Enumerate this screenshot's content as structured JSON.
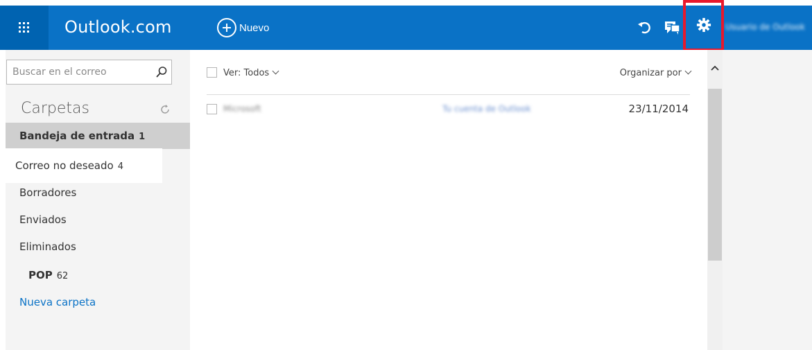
{
  "header": {
    "brand": "Outlook.com",
    "new_label": "Nuevo",
    "user_name": "Usuario de Outlook",
    "accent": "#0a72c6",
    "highlight_color": "#e8182c",
    "icons": [
      "app-launcher-icon",
      "plus-circle-icon",
      "undo-icon",
      "chat-icon",
      "gear-icon"
    ]
  },
  "sidebar": {
    "search_placeholder": "Buscar en el correo",
    "folders_title": "Carpetas",
    "folders": [
      {
        "label": "Bandeja de entrada",
        "count": "1"
      },
      {
        "label": "Correo no deseado",
        "count": "4"
      },
      {
        "label": "Borradores",
        "count": ""
      },
      {
        "label": "Enviados",
        "count": ""
      },
      {
        "label": "Eliminados",
        "count": ""
      },
      {
        "label": "POP",
        "count": "62"
      }
    ],
    "new_folder": "Nueva carpeta"
  },
  "list": {
    "filter_label": "Ver: Todos",
    "sort_label": "Organizar por",
    "messages": [
      {
        "sender": "Microsoft",
        "subject": "Tu cuenta de Outlook",
        "date": "23/11/2014"
      }
    ]
  }
}
